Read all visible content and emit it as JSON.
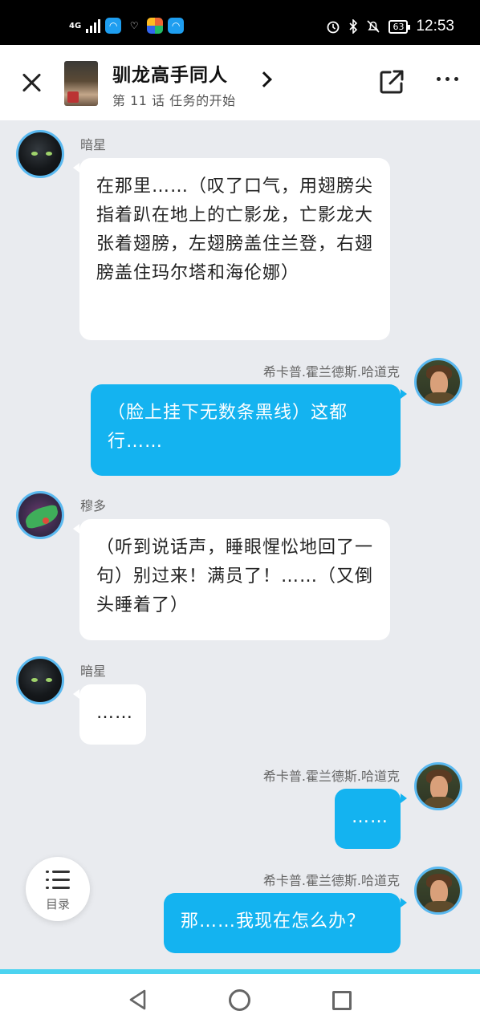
{
  "status_bar": {
    "network": "4G",
    "battery": "63",
    "time": "12:53"
  },
  "header": {
    "title": "驯龙高手同人",
    "chapter": "第 11 话  任务的开始"
  },
  "messages": [
    {
      "sender": "暗星",
      "side": "left",
      "text": "在那里……（叹了口气，用翅膀尖指着趴在地上的亡影龙，亡影龙大张着翅膀，左翅膀盖住兰登，右翅膀盖住玛尔塔和海伦娜）"
    },
    {
      "sender": "希卡普.霍兰德斯.哈道克",
      "side": "right",
      "text": "（脸上挂下无数条黑线）这都行……"
    },
    {
      "sender": "穆多",
      "side": "left",
      "text": "（听到说话声，睡眼惺忪地回了一句）别过来！满员了！……（又倒头睡着了）"
    },
    {
      "sender": "暗星",
      "side": "left",
      "text": "……"
    },
    {
      "sender": "希卡普.霍兰德斯.哈道克",
      "side": "right",
      "text": "……"
    },
    {
      "sender": "希卡普.霍兰德斯.哈道克",
      "side": "right",
      "text": "那……我现在怎么办？"
    }
  ],
  "toc": {
    "label": "目录"
  },
  "colors": {
    "accent": "#14b3f0",
    "avatar_ring": "#5ab9f0",
    "background": "#e9ebef"
  },
  "icons": [
    "close-icon",
    "chevron-right-icon",
    "share-icon",
    "more-icon",
    "toc-list-icon",
    "back-icon",
    "home-icon",
    "recent-apps-icon"
  ]
}
